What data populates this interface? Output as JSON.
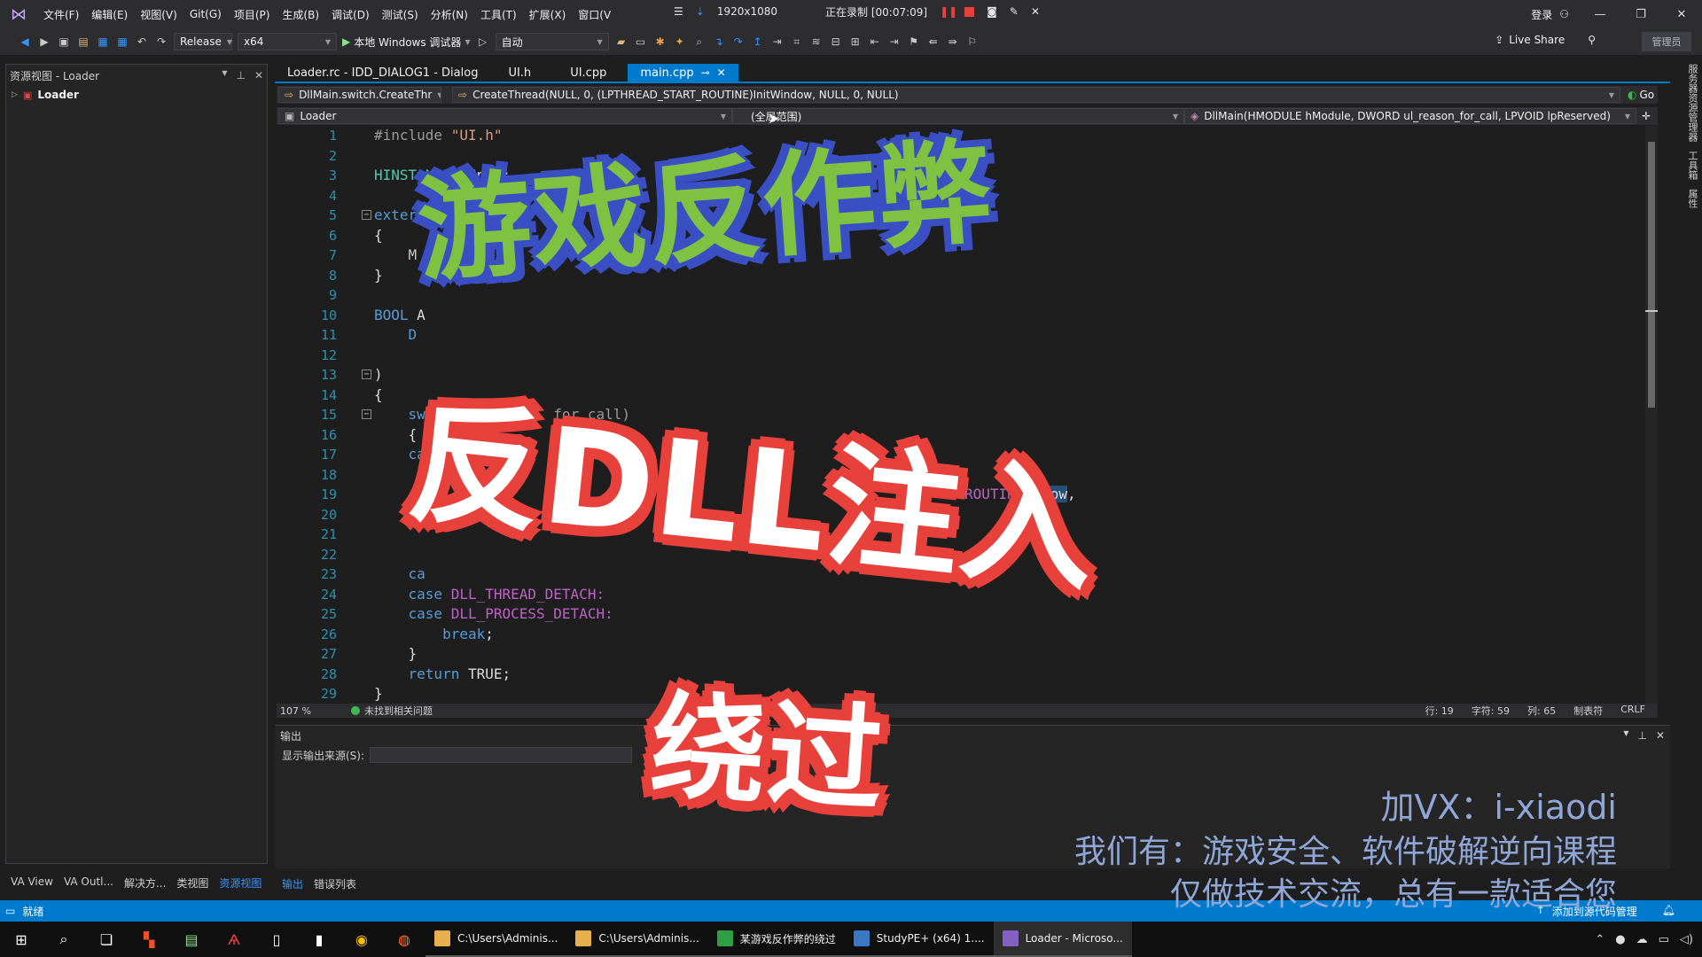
{
  "menubar": {
    "items": [
      "文件(F)",
      "编辑(E)",
      "视图(V)",
      "Git(G)",
      "项目(P)",
      "生成(B)",
      "调试(D)",
      "测试(S)",
      "分析(N)",
      "工具(T)",
      "扩展(X)",
      "窗口(V"
    ],
    "recorder_resolution": "1920x1080",
    "recorder_status": "正在录制 [00:07:09]",
    "login": "登录"
  },
  "toolbar": {
    "config": "Release",
    "platform": "x64",
    "run_label": "本地 Windows 调试器",
    "mode": "自动",
    "live_share": "Live Share",
    "admin": "管理员"
  },
  "solution": {
    "title": "资源视图 - Loader",
    "root": "Loader"
  },
  "left_tabs": [
    "VA View",
    "VA Outl...",
    "解决方...",
    "类视图",
    "资源视图"
  ],
  "doc_tabs": [
    "Loader.rc - IDD_DIALOG1 - Dialog",
    "UI.h",
    "UI.cpp",
    "main.cpp"
  ],
  "nav": {
    "scope": "DllMain.switch.CreateThr",
    "statement": "CreateThread(NULL, 0, (LPTHREAD_START_ROUTINE)InitWindow, NULL, 0, NULL)",
    "go": "Go",
    "project": "Loader",
    "global": "(全局范围)",
    "function": "DllMain(HMODULE hModule, DWORD ul_reason_for_call, LPVOID lpReserved)"
  },
  "code": {
    "line_numbers": [
      "1",
      "2",
      "3",
      "4",
      "5",
      "6",
      "7",
      "8",
      "9",
      "10",
      "11",
      "12",
      "13",
      "14",
      "15",
      "16",
      "17",
      "18",
      "19",
      "20",
      "21",
      "22",
      "23",
      "24",
      "25",
      "26",
      "27",
      "28",
      "29"
    ],
    "l1_pp": "#include",
    "l1_str": " \"UI.h\"",
    "l3_type": "HINSTANCE",
    "l3_rest": " hInst;",
    "l5": "exter",
    "l6": "{",
    "l7": "    M",
    "l8": "}",
    "l10_kw": "BOOL",
    "l10_rest": " A",
    "l11": "    D",
    "l12": "    ",
    "l13": ")",
    "l14": "{",
    "l15_kw": "    swi",
    "l15_rest": "              for_call)",
    "l16": "    {",
    "l17_kw": "    ca",
    "l19_rest": "ROUTINE",
    "l19_sel": "ndow",
    "l19_end": ",",
    "l20_rest": "l",
    "l23_kw": "    ca",
    "l24_kw": "    case",
    "l24_mac": " DLL_THREAD_DETACH:",
    "l25_kw": "    case",
    "l25_mac": " DLL_PROCESS_DETACH:",
    "l26_kw": "        break",
    "l26_rest": ";",
    "l27": "    }",
    "l28_kw": "    return",
    "l28_rest": " TRUE;",
    "l29": "}"
  },
  "editor_status": {
    "zoom": "107 %",
    "issues": "未找到相关问题",
    "line": "行: 19",
    "char": "字符: 59",
    "col": "列: 65",
    "tabs": "制表符",
    "eol": "CRLF"
  },
  "output": {
    "title": "输出",
    "source_label": "显示输出来源(S):",
    "tabs": [
      "输出",
      "错误列表"
    ]
  },
  "statusbar": {
    "ready": "就绪",
    "source_control": "添加到源代码管理"
  },
  "right_vtabs": [
    "服务器资源管理器",
    "工具箱",
    "属性"
  ],
  "taskbar": {
    "windows": [
      "C:\\Users\\Adminis...",
      "C:\\Users\\Adminis...",
      "某游戏反作弊的绕过",
      "StudyPE+ (x64) 1....",
      "Loader - Microso..."
    ]
  },
  "overlay": {
    "line1": "游戏反作弊",
    "line2": "反DLL注入",
    "line3": "绕过",
    "promo1": "加VX：i-xiaodi",
    "promo2": "我们有：游戏安全、软件破解逆向课程",
    "promo3": "仅做技术交流，总有一款适合您"
  }
}
